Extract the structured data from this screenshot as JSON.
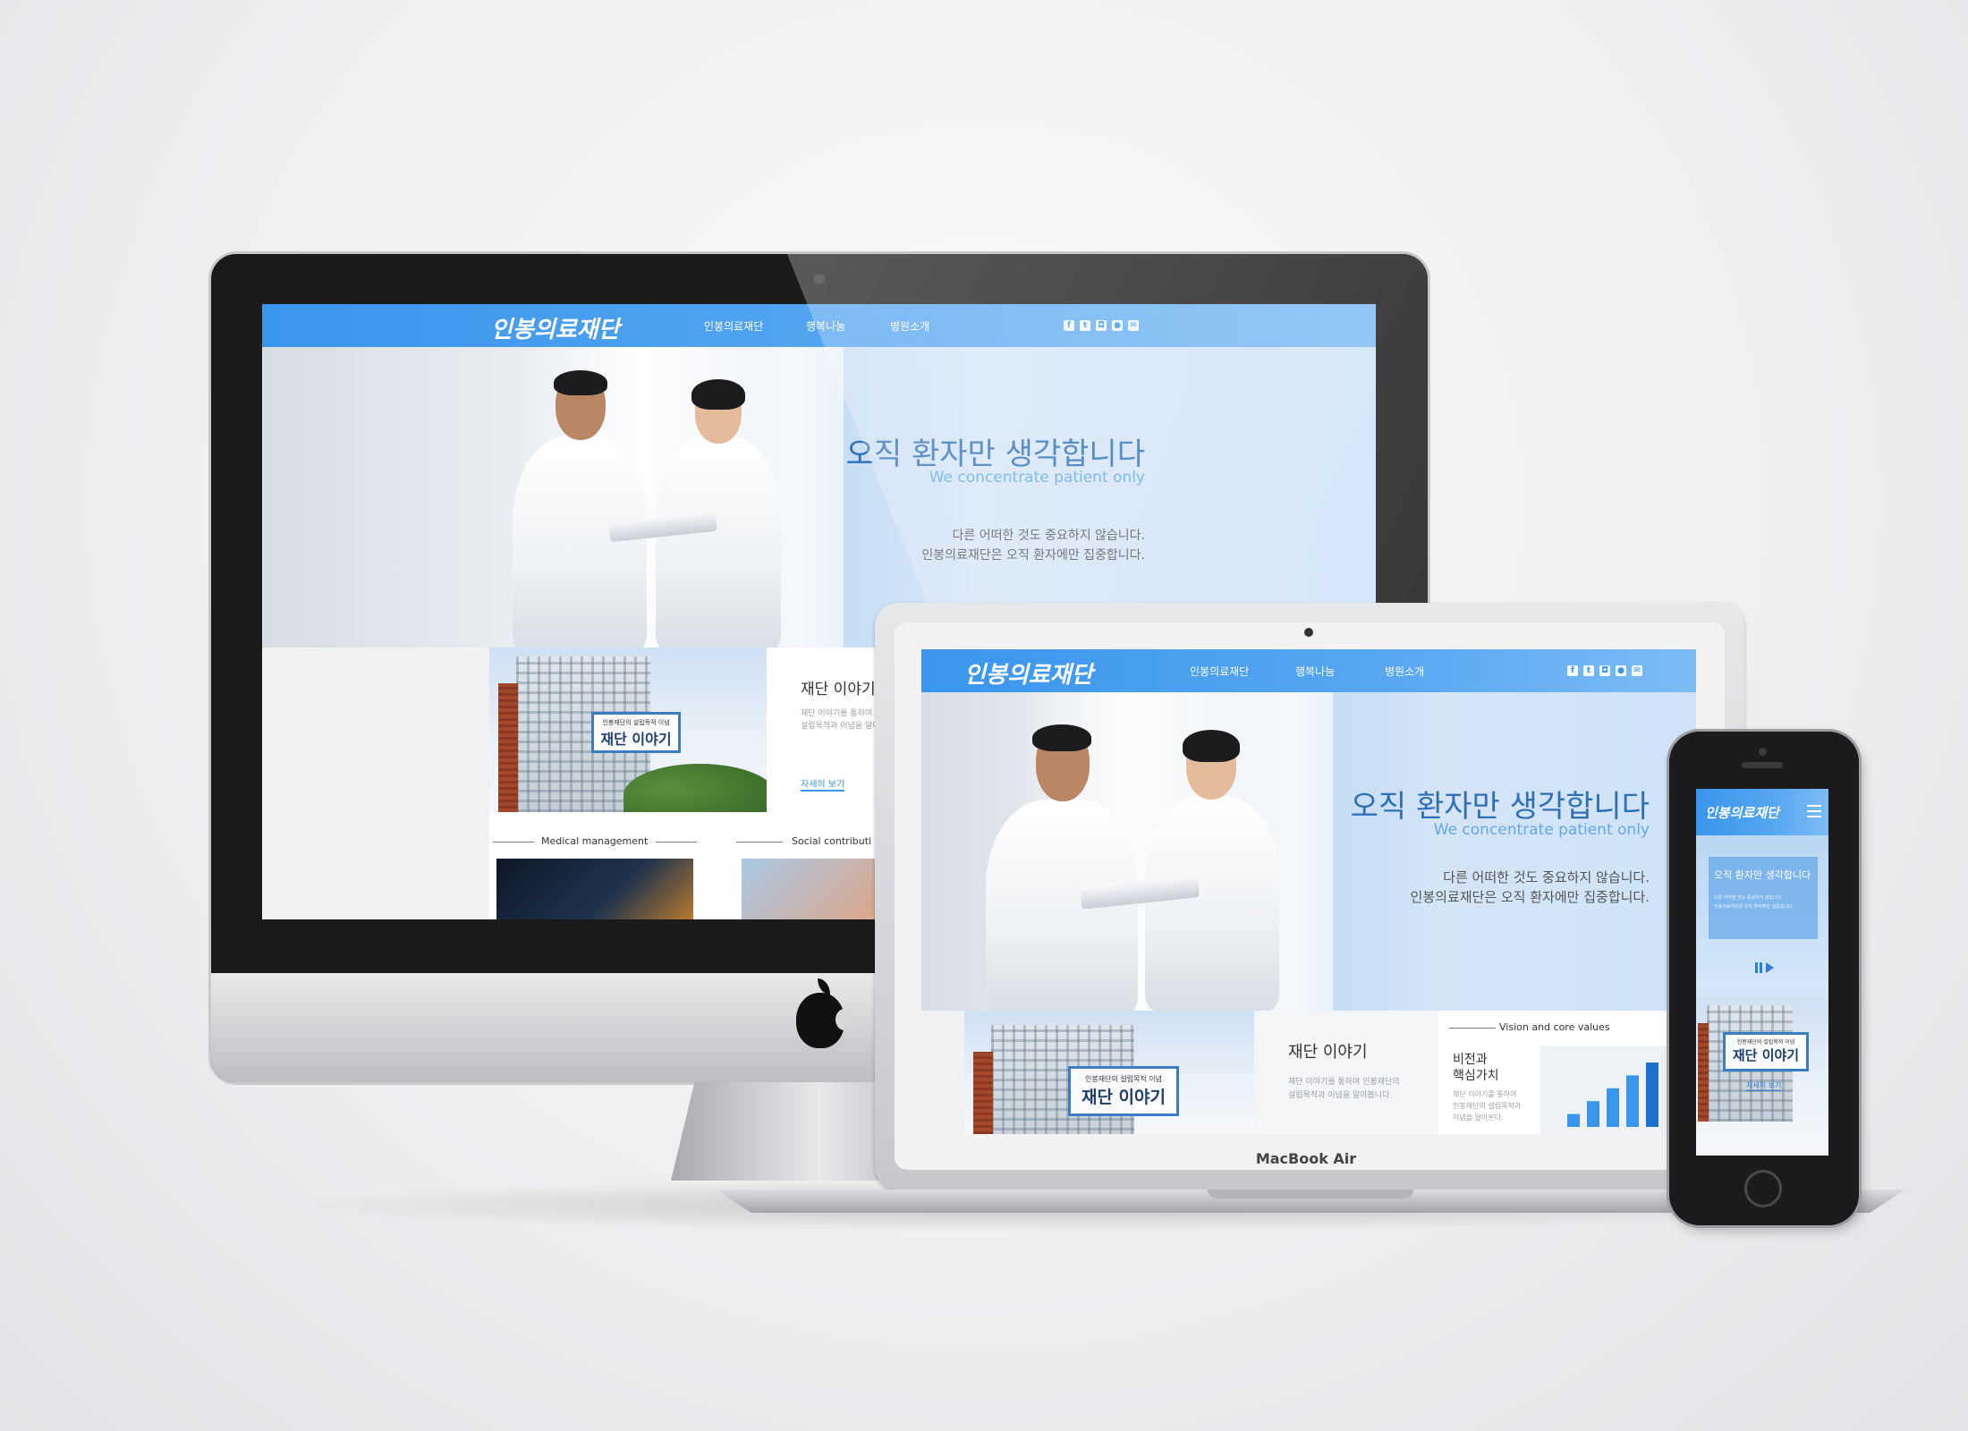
{
  "site": {
    "logo": "인봉의료재단",
    "menu": [
      "인봉의료재단",
      "행복나눔",
      "병원소개"
    ],
    "social_icons": [
      "facebook-icon",
      "twitter-icon",
      "instagram-icon",
      "chat-icon",
      "mail-icon"
    ],
    "hero": {
      "title": "오직 환자만 생각합니다",
      "subtitle": "We concentrate patient only",
      "line1": "다른 어떠한 것도 중요하지 않습니다.",
      "line2": "인봉의료재단은 오직 환자에만 집중합니다."
    },
    "story_card": {
      "stamp_small": "인봉재단의 설립목적 이념",
      "stamp_big": "재단 이야기",
      "title": "재단 이야기",
      "text_line1": "재단 이야기를 통하여 인봉재단의",
      "text_line2": "설립목적과 이념을 알아봅니다.",
      "more": "자세히 보기"
    },
    "sections": {
      "medical": "Medical management",
      "social": "Social contributi",
      "vision": "Vision and core values"
    },
    "vision_card": {
      "title_line1": "비전과",
      "title_line2": "핵심가치",
      "text_line1": "재단 이야기를 통하여",
      "text_line2": "인봉재단의 설립목적과",
      "text_line3": "이념을 알아본다."
    }
  },
  "devices": {
    "laptop_label": "MacBook Air"
  },
  "colors": {
    "accent": "#3a95ec",
    "title_blue": "#2f6fb6"
  },
  "vision_chart": {
    "type": "bar",
    "values": [
      1,
      2,
      3,
      4,
      5
    ]
  }
}
